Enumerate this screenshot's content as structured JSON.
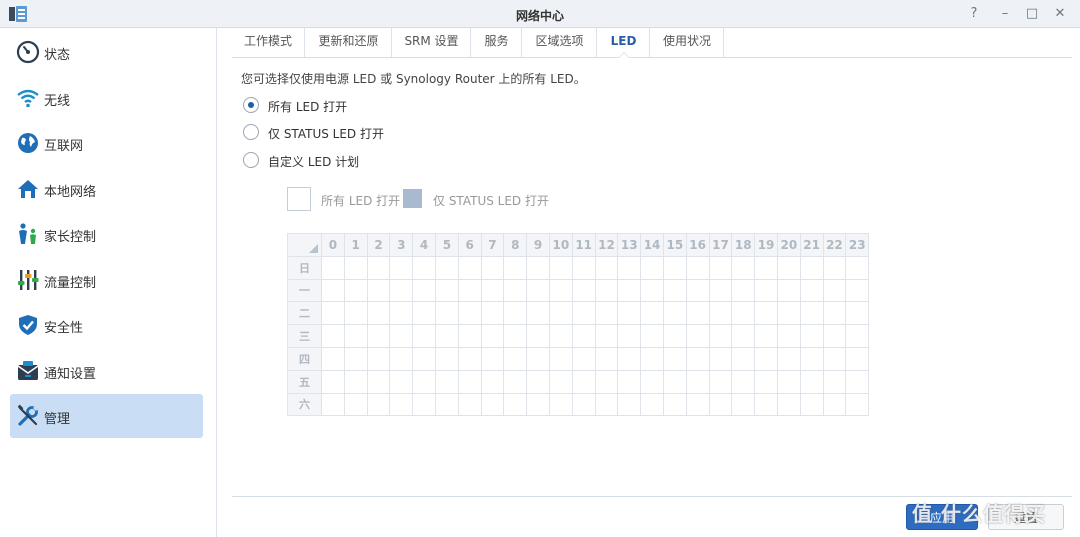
{
  "window": {
    "title": "网络中心",
    "controls": [
      "?",
      "–",
      "□",
      "✕"
    ]
  },
  "sidebar": {
    "items": [
      {
        "label": "状态",
        "icon": "status-gauge-icon"
      },
      {
        "label": "无线",
        "icon": "wifi-icon"
      },
      {
        "label": "互联网",
        "icon": "globe-icon"
      },
      {
        "label": "本地网络",
        "icon": "home-network-icon"
      },
      {
        "label": "家长控制",
        "icon": "family-icon"
      },
      {
        "label": "流量控制",
        "icon": "sliders-icon"
      },
      {
        "label": "安全性",
        "icon": "shield-icon"
      },
      {
        "label": "通知设置",
        "icon": "notification-icon"
      },
      {
        "label": "管理",
        "icon": "wrench-icon",
        "active": true
      }
    ]
  },
  "tabs": [
    {
      "label": "工作模式"
    },
    {
      "label": "更新和还原"
    },
    {
      "label": "SRM 设置"
    },
    {
      "label": "服务"
    },
    {
      "label": "区域选项"
    },
    {
      "label": "LED",
      "active": true
    },
    {
      "label": "使用状况"
    }
  ],
  "led": {
    "description": "您可选择仅使用电源 LED 或 Synology Router 上的所有 LED。",
    "options": [
      {
        "label": "所有 LED 打开",
        "selected": true
      },
      {
        "label": "仅 STATUS LED 打开",
        "selected": false
      },
      {
        "label": "自定义 LED 计划",
        "selected": false
      }
    ],
    "legend": [
      {
        "label": "所有 LED 打开",
        "color": "#ffffff"
      },
      {
        "label": "仅 STATUS LED 打开",
        "color": "#a8b9d0"
      }
    ],
    "schedule": {
      "hours": [
        "0",
        "1",
        "2",
        "3",
        "4",
        "5",
        "6",
        "7",
        "8",
        "9",
        "10",
        "11",
        "12",
        "13",
        "14",
        "15",
        "16",
        "17",
        "18",
        "19",
        "20",
        "21",
        "22",
        "23"
      ],
      "days": [
        "日",
        "一",
        "二",
        "三",
        "四",
        "五",
        "六"
      ]
    }
  },
  "footer": {
    "apply_label": "应用",
    "reset_label": "重置"
  },
  "watermark": "值 什么值得买"
}
